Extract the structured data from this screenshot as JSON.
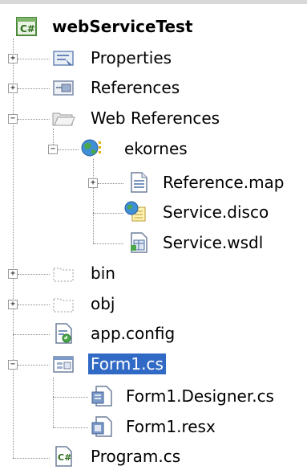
{
  "project": {
    "name": "webServiceTest",
    "icon": "csharp-project-icon",
    "items": {
      "properties": "Properties",
      "references": "References",
      "web_references": {
        "label": "Web References",
        "ekornes": {
          "label": "ekornes",
          "reference_map": "Reference.map",
          "service_disco": "Service.disco",
          "service_wsdl": "Service.wsdl"
        }
      },
      "bin": "bin",
      "obj": "obj",
      "app_config": "app.config",
      "form1": {
        "label": "Form1.cs",
        "designer": "Form1.Designer.cs",
        "resx": "Form1.resx"
      },
      "program": "Program.cs"
    }
  },
  "expander": {
    "plus": "+",
    "minus": "−"
  },
  "colors": {
    "selection": "#316ac5",
    "tree_line": "#8d8d8d"
  }
}
